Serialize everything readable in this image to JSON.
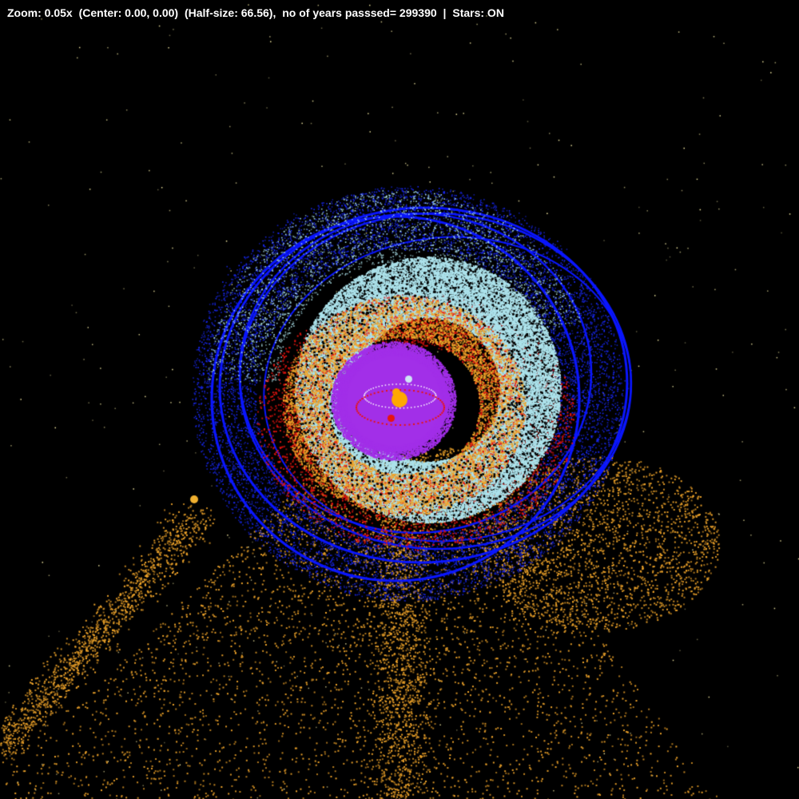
{
  "status_bar": {
    "zoom": "Zoom: 0.05x",
    "center": "(Center: 0.00, 0.00)",
    "half_size": "(Half-size: 66.56),",
    "years": "no of years passsed= 299390",
    "separator": "|",
    "stars": "Stars: ON"
  },
  "colors": {
    "background": "#000000",
    "text": "#ffffff",
    "outer_ring": "#0a16ff",
    "outer_scatter": "#1a2aff",
    "ice_disk": "#ade3ec",
    "dust_orange": "#f1a52a",
    "dust_red": "#e8140f",
    "inner_disk": "#a22fe8",
    "sun": "#ffa800",
    "star_field": "#f0e6a0",
    "outlier_body": "#f0b030"
  },
  "icons": {
    "sun": "sun-icon",
    "planet_red": "planet-icon",
    "planet_light": "planet-icon",
    "outlier": "dwarf-planet-icon"
  }
}
